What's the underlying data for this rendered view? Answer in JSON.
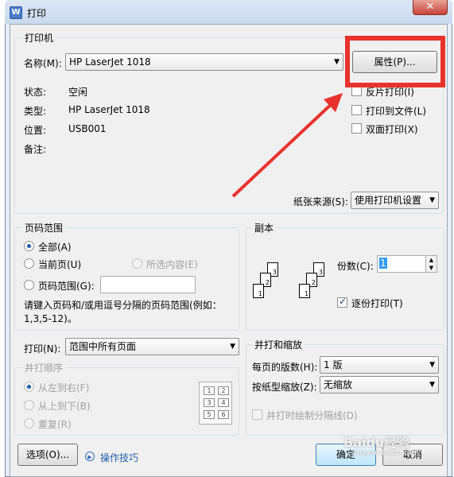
{
  "window": {
    "title": "打印",
    "app_icon": "W",
    "close_glyph": "✕"
  },
  "printer": {
    "group_title": "打印机",
    "name_label": "名称(M):",
    "name_value": "HP LaserJet 1018",
    "properties_button": "属性(P)...",
    "status_label": "状态:",
    "status_value": "空闲",
    "type_label": "类型:",
    "type_value": "HP LaserJet 1018",
    "location_label": "位置:",
    "location_value": "USB001",
    "comment_label": "备注:",
    "reverse_print": "反片打印(I)",
    "print_to_file": "打印到文件(L)",
    "duplex": "双面打印(X)",
    "paper_source_label": "纸张来源(S):",
    "paper_source_value": "使用打印机设置"
  },
  "page_range": {
    "group_title": "页码范围",
    "all": "全部(A)",
    "current": "当前页(U)",
    "selection": "所选内容(E)",
    "pages": "页码范围(G):",
    "hint": "请键入页码和/或用逗号分隔的页码范围(例如：1,3,5-12)。"
  },
  "copies": {
    "group_title": "副本",
    "count_label": "份数(C):",
    "count_value": "1",
    "collate": "逐份打印(T)",
    "pages_a": [
      "3",
      "2",
      "1"
    ],
    "pages_b": [
      "3",
      "2",
      "1"
    ]
  },
  "print_what": {
    "label": "打印(N):",
    "value": "范围中所有页面"
  },
  "order": {
    "group_title": "并打顺序",
    "ltr": "从左到右(F)",
    "ttb": "从上到下(B)",
    "repeat": "重复(R)",
    "grid": [
      "1",
      "2",
      "3",
      "4",
      "5",
      "6"
    ]
  },
  "zoom": {
    "group_title": "并打和缩放",
    "pages_per_sheet_label": "每页的版数(H):",
    "pages_per_sheet_value": "1 版",
    "scale_label": "按纸型缩放(Z):",
    "scale_value": "无缩放",
    "draw_borders": "并打时绘制分隔线(D)"
  },
  "footer": {
    "options_button": "选项(O)...",
    "tips_link": "操作技巧",
    "ok_button": "确定",
    "cancel_button": "取消"
  },
  "watermark": {
    "brand": "Baidu经验",
    "url": "jingyan.baidu.com"
  },
  "annotation": {
    "color": "#e8322c"
  }
}
